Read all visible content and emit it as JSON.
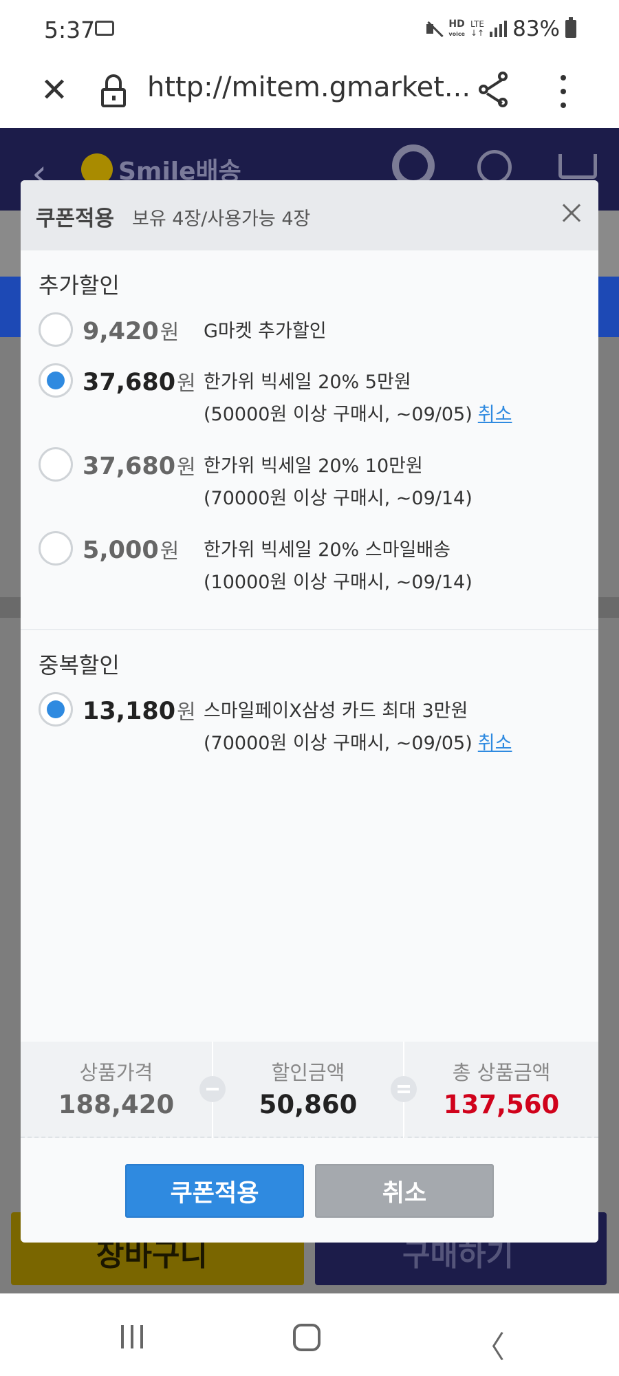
{
  "status_bar": {
    "time": "5:37",
    "hd": "HD",
    "lte": "LTE",
    "battery": "83%"
  },
  "browser": {
    "url": "http://mitem.gmarket..."
  },
  "background_page": {
    "logo_text": "Smile배송",
    "cart_button": "장바구니",
    "buy_button": "구매하기"
  },
  "modal": {
    "title": "쿠폰적용",
    "subtitle": "보유 4장/사용가능 4장",
    "sections": [
      {
        "title": "추가할인",
        "coupons": [
          {
            "amount": "9,420",
            "unit": "원",
            "line1": "G마켓 추가할인",
            "line2": "",
            "selected": false
          },
          {
            "amount": "37,680",
            "unit": "원",
            "line1": "한가위 빅세일 20% 5만원",
            "line2": "(50000원 이상 구매시, ~09/05)",
            "cancel": "취소",
            "selected": true
          },
          {
            "amount": "37,680",
            "unit": "원",
            "line1": "한가위 빅세일 20% 10만원",
            "line2": "(70000원 이상 구매시, ~09/14)",
            "selected": false
          },
          {
            "amount": "5,000",
            "unit": "원",
            "line1": "한가위 빅세일 20% 스마일배송",
            "line2": "(10000원 이상 구매시, ~09/14)",
            "selected": false
          }
        ]
      },
      {
        "title": "중복할인",
        "coupons": [
          {
            "amount": "13,180",
            "unit": "원",
            "line1": "스마일페이X삼성 카드 최대 3만원",
            "line2": "(70000원 이상 구매시, ~09/05)",
            "cancel": "취소",
            "selected": true
          }
        ]
      }
    ],
    "summary": {
      "product_price_label": "상품가격",
      "product_price": "188,420",
      "discount_label": "할인금액",
      "discount": "50,860",
      "total_label": "총 상품금액",
      "total": "137,560"
    },
    "apply_button": "쿠폰적용",
    "cancel_button": "취소"
  },
  "colors": {
    "accent_blue": "#2f8ae0",
    "total_red": "#d0021b",
    "header_navy": "#1c1c4a"
  }
}
